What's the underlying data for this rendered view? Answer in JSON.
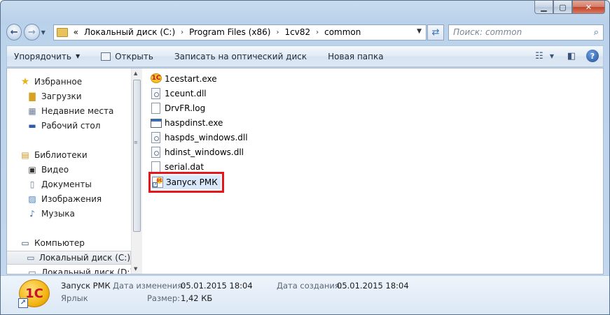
{
  "window": {
    "caption_buttons": [
      "minimize",
      "maximize",
      "close"
    ]
  },
  "address": {
    "back_label": "←",
    "forward_label": "→",
    "overflow": "«",
    "crumbs": [
      "Локальный диск (C:)",
      "Program Files (x86)",
      "1cv82",
      "common"
    ],
    "search_placeholder": "Поиск: common"
  },
  "toolbar": {
    "organize": "Упорядочить",
    "open": "Открыть",
    "burn": "Записать на оптический диск",
    "new_folder": "Новая папка"
  },
  "sidebar": {
    "items": [
      {
        "label": "Избранное",
        "icon": "star-icon"
      },
      {
        "label": "Загрузки",
        "icon": "downloads-folder-icon"
      },
      {
        "label": "Недавние места",
        "icon": "recent-places-icon"
      },
      {
        "label": "Рабочий стол",
        "icon": "desktop-icon"
      },
      {
        "label": "Библиотеки",
        "icon": "libraries-icon"
      },
      {
        "label": "Видео",
        "icon": "video-icon"
      },
      {
        "label": "Документы",
        "icon": "documents-icon"
      },
      {
        "label": "Изображения",
        "icon": "pictures-icon"
      },
      {
        "label": "Музыка",
        "icon": "music-icon"
      },
      {
        "label": "Компьютер",
        "icon": "computer-icon"
      },
      {
        "label": "Локальный диск (C:)",
        "icon": "drive-icon"
      },
      {
        "label": "Локальный диск (D:)",
        "icon": "drive-icon"
      }
    ]
  },
  "files": [
    {
      "name": "1cestart.exe",
      "type": "onec"
    },
    {
      "name": "1ceunt.dll",
      "type": "dll"
    },
    {
      "name": "DrvFR.log",
      "type": "doc"
    },
    {
      "name": "haspdinst.exe",
      "type": "exe"
    },
    {
      "name": "haspds_windows.dll",
      "type": "dll"
    },
    {
      "name": "hdinst_windows.dll",
      "type": "dll"
    },
    {
      "name": "serial.dat",
      "type": "doc"
    },
    {
      "name": "Запуск РМК",
      "type": "lnk",
      "highlighted": true
    }
  ],
  "details": {
    "icon_text": "1С",
    "name": "Запуск РМК",
    "type": "Ярлык",
    "modified_label": "Дата изменения:",
    "modified_value": "05.01.2015 18:04",
    "size_label": "Размер:",
    "size_value": "1,42 КБ",
    "created_label": "Дата создания:",
    "created_value": "05.01.2015 18:04"
  },
  "colors": {
    "highlight_border": "#e3181e",
    "window_frame": "#b9d1ea"
  }
}
